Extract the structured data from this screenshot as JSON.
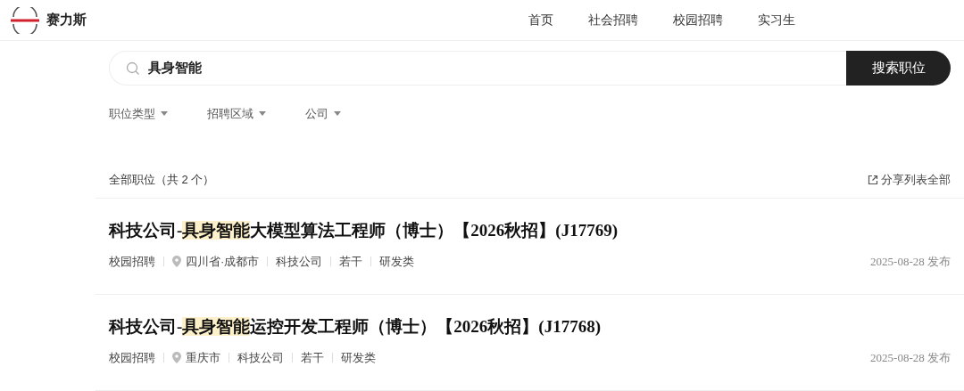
{
  "header": {
    "brand": "赛力斯",
    "nav": [
      {
        "label": "首页"
      },
      {
        "label": "社会招聘"
      },
      {
        "label": "校园招聘"
      },
      {
        "label": "实习生"
      }
    ]
  },
  "search": {
    "value": "具身智能",
    "button": "搜索职位"
  },
  "filters": [
    {
      "label": "职位类型"
    },
    {
      "label": "招聘区域"
    },
    {
      "label": "公司"
    }
  ],
  "summary": {
    "label": "全部职位（共 2 个）",
    "share": "分享列表全部"
  },
  "jobs": [
    {
      "title": [
        {
          "text": "科技公司-",
          "highlighted": false
        },
        {
          "text": "具身智能",
          "highlighted": true
        },
        {
          "text": "大模型算法工程师（博士）【2026秋招】(J17769)",
          "highlighted": false
        }
      ],
      "tags": [
        {
          "text": "校园招聘",
          "kind": "plain"
        },
        {
          "text": "四川省·成都市",
          "kind": "location"
        },
        {
          "text": "科技公司",
          "kind": "plain"
        },
        {
          "text": "若干",
          "kind": "plain"
        },
        {
          "text": "研发类",
          "kind": "plain"
        }
      ],
      "date": "2025-08-28 发布"
    },
    {
      "title": [
        {
          "text": "科技公司-",
          "highlighted": false
        },
        {
          "text": "具身智能",
          "highlighted": true
        },
        {
          "text": "运控开发工程师（博士）【2026秋招】(J17768)",
          "highlighted": false
        }
      ],
      "tags": [
        {
          "text": "校园招聘",
          "kind": "plain"
        },
        {
          "text": "重庆市",
          "kind": "location"
        },
        {
          "text": "科技公司",
          "kind": "plain"
        },
        {
          "text": "若干",
          "kind": "plain"
        },
        {
          "text": "研发类",
          "kind": "plain"
        }
      ],
      "date": "2025-08-28 发布"
    }
  ]
}
